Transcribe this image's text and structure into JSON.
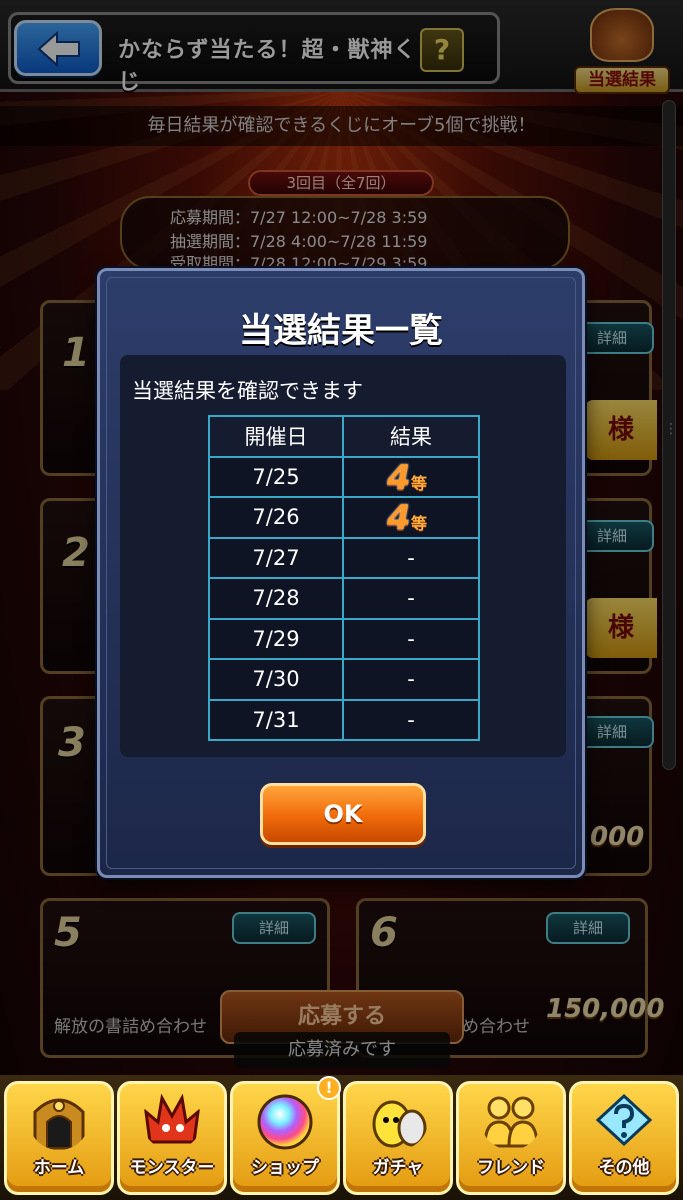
{
  "header": {
    "title": "かならず当たる！超・獣神くじ",
    "help_label": "?",
    "result_badge_label": "当選結果"
  },
  "subtitle": "毎日結果が確認できるくじにオーブ5個で挑戦！",
  "round": "3回目（全7回）",
  "periods": [
    "応募期間：7/27 12:00~7/28 3:59",
    "抽選期間：7/28 4:00~7/28 11:59",
    "受取期間：7/28 12:00~7/29 3:59"
  ],
  "background_tiles": {
    "detail_label": "詳細",
    "sama_label": "様",
    "tile5_rank": "5",
    "tile5_caption": "解放の書詰め合わせ",
    "tile6_rank": "6",
    "tile6_caption": "め合わせ",
    "tile6_count": "150,000",
    "count_000": "000"
  },
  "apply_button": "応募する",
  "applied_status": "応募済みです",
  "modal": {
    "title": "当選結果一覧",
    "description": "当選結果を確認できます",
    "table": {
      "headers": [
        "開催日",
        "結果"
      ],
      "rows": [
        {
          "date": "7/25",
          "result": "4",
          "unit": "等"
        },
        {
          "date": "7/26",
          "result": "4",
          "unit": "等"
        },
        {
          "date": "7/27",
          "result": "-"
        },
        {
          "date": "7/28",
          "result": "-"
        },
        {
          "date": "7/29",
          "result": "-"
        },
        {
          "date": "7/30",
          "result": "-"
        },
        {
          "date": "7/31",
          "result": "-"
        }
      ]
    },
    "ok_label": "OK"
  },
  "bottom_nav": [
    {
      "label": "ホーム",
      "icon": "home-gate-icon"
    },
    {
      "label": "モンスター",
      "icon": "monster-icon"
    },
    {
      "label": "ショップ",
      "icon": "orb-icon",
      "notice": "!"
    },
    {
      "label": "ガチャ",
      "icon": "egg-icon"
    },
    {
      "label": "フレンド",
      "icon": "friends-icon"
    },
    {
      "label": "その他",
      "icon": "other-icon"
    }
  ],
  "colors": {
    "modal_bg": "#2d3d6a",
    "table_border": "#3aa8c8",
    "ok_button": "#f06a0a",
    "nav_gold": "#ffd64a",
    "prize_orange": "#ff9a2a"
  }
}
